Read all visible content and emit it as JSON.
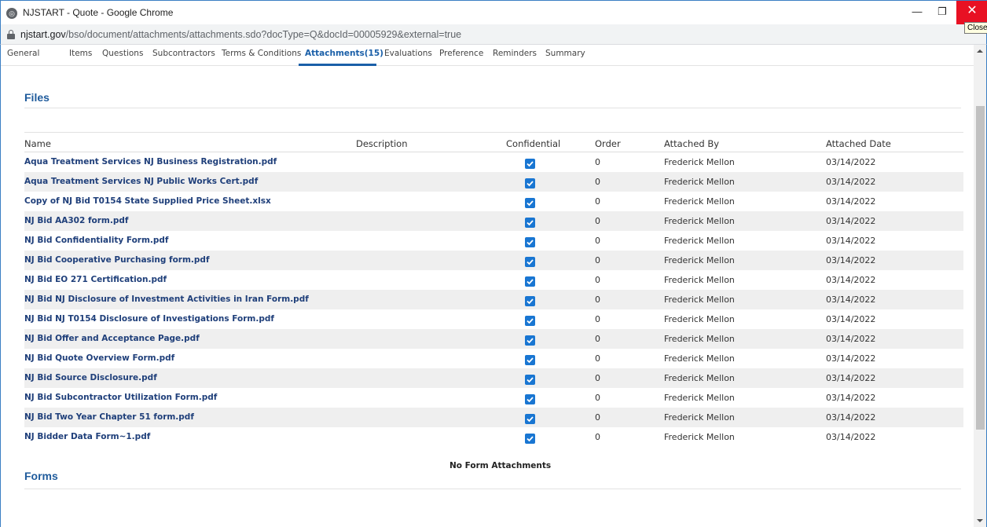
{
  "window": {
    "title": "NJSTART - Quote - Google Chrome",
    "close_tooltip": "Close"
  },
  "address": {
    "host": "njstart.gov",
    "path": "/bso/document/attachments/attachments.sdo?docType=Q&docId=00005929&external=true"
  },
  "tabs": [
    {
      "label": "General"
    },
    {
      "label": "Items"
    },
    {
      "label": "Questions"
    },
    {
      "label": "Subcontractors"
    },
    {
      "label": "Terms & Conditions"
    },
    {
      "label": "Attachments(15)",
      "active": true
    },
    {
      "label": "Evaluations"
    },
    {
      "label": "Preference"
    },
    {
      "label": "Reminders"
    },
    {
      "label": "Summary"
    }
  ],
  "files": {
    "title": "Files",
    "columns": {
      "name": "Name",
      "description": "Description",
      "confidential": "Confidential",
      "order": "Order",
      "attached_by": "Attached By",
      "attached_date": "Attached Date"
    },
    "rows": [
      {
        "name": "Aqua Treatment Services NJ Business Registration.pdf",
        "confidential": true,
        "order": "0",
        "attached_by": "Frederick Mellon",
        "attached_date": "03/14/2022"
      },
      {
        "name": "Aqua Treatment Services NJ Public Works Cert.pdf",
        "confidential": true,
        "order": "0",
        "attached_by": "Frederick Mellon",
        "attached_date": "03/14/2022"
      },
      {
        "name": "Copy of NJ Bid T0154 State Supplied Price Sheet.xlsx",
        "confidential": true,
        "order": "0",
        "attached_by": "Frederick Mellon",
        "attached_date": "03/14/2022"
      },
      {
        "name": "NJ Bid AA302 form.pdf",
        "confidential": true,
        "order": "0",
        "attached_by": "Frederick Mellon",
        "attached_date": "03/14/2022"
      },
      {
        "name": "NJ Bid Confidentiality Form.pdf",
        "confidential": true,
        "order": "0",
        "attached_by": "Frederick Mellon",
        "attached_date": "03/14/2022"
      },
      {
        "name": "NJ Bid Cooperative Purchasing form.pdf",
        "confidential": true,
        "order": "0",
        "attached_by": "Frederick Mellon",
        "attached_date": "03/14/2022"
      },
      {
        "name": "NJ Bid EO 271 Certification.pdf",
        "confidential": true,
        "order": "0",
        "attached_by": "Frederick Mellon",
        "attached_date": "03/14/2022"
      },
      {
        "name": "NJ Bid NJ Disclosure of Investment Activities in Iran Form.pdf",
        "confidential": true,
        "order": "0",
        "attached_by": "Frederick Mellon",
        "attached_date": "03/14/2022"
      },
      {
        "name": "NJ Bid NJ T0154 Disclosure of Investigations Form.pdf",
        "confidential": true,
        "order": "0",
        "attached_by": "Frederick Mellon",
        "attached_date": "03/14/2022"
      },
      {
        "name": "NJ Bid Offer and Acceptance Page.pdf",
        "confidential": true,
        "order": "0",
        "attached_by": "Frederick Mellon",
        "attached_date": "03/14/2022"
      },
      {
        "name": "NJ Bid Quote Overview Form.pdf",
        "confidential": true,
        "order": "0",
        "attached_by": "Frederick Mellon",
        "attached_date": "03/14/2022"
      },
      {
        "name": "NJ Bid Source Disclosure.pdf",
        "confidential": true,
        "order": "0",
        "attached_by": "Frederick Mellon",
        "attached_date": "03/14/2022"
      },
      {
        "name": "NJ Bid Subcontractor Utilization Form.pdf",
        "confidential": true,
        "order": "0",
        "attached_by": "Frederick Mellon",
        "attached_date": "03/14/2022"
      },
      {
        "name": "NJ Bid Two Year Chapter 51 form.pdf",
        "confidential": true,
        "order": "0",
        "attached_by": "Frederick Mellon",
        "attached_date": "03/14/2022"
      },
      {
        "name": "NJ Bidder Data Form~1.pdf",
        "confidential": true,
        "order": "0",
        "attached_by": "Frederick Mellon",
        "attached_date": "03/14/2022"
      }
    ]
  },
  "forms": {
    "title": "Forms",
    "empty_text": "No Form Attachments"
  },
  "colors": {
    "accent": "#1a5fa8",
    "link": "#1f3f7a",
    "checkbox": "#1976d2",
    "row_alt": "#efefef",
    "close": "#e81123"
  }
}
